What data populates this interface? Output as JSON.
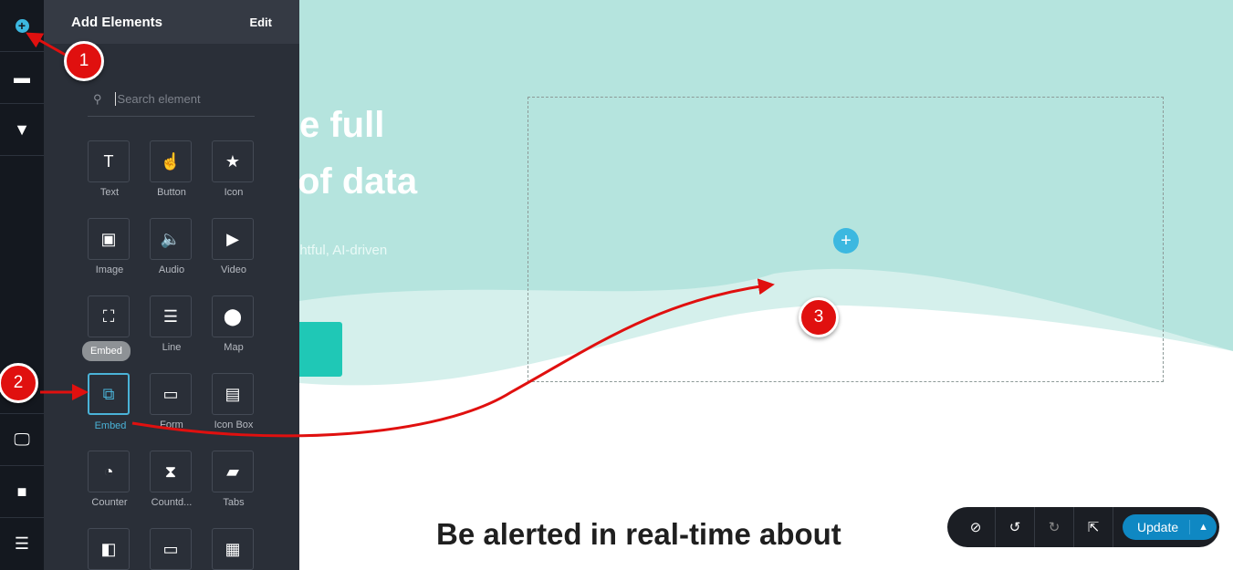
{
  "rail": {
    "items": [
      {
        "icon": "add-circle-icon"
      },
      {
        "icon": "layers-icon"
      },
      {
        "icon": "paint-roller-icon"
      },
      {
        "icon": "desktop-icon"
      },
      {
        "icon": "note-icon"
      },
      {
        "icon": "menu-icon"
      }
    ]
  },
  "panel": {
    "title": "Add Elements",
    "edit_label": "Edit",
    "search_placeholder": "Search element",
    "elements": [
      {
        "label": "Text",
        "icon": "T"
      },
      {
        "label": "Button",
        "icon": "☝"
      },
      {
        "label": "Icon",
        "icon": "★"
      },
      {
        "label": "Image",
        "icon": "▣"
      },
      {
        "label": "Audio",
        "icon": "🔈"
      },
      {
        "label": "Video",
        "icon": "▶"
      },
      {
        "label": "",
        "icon": "⛶"
      },
      {
        "label": "Line",
        "icon": "☰"
      },
      {
        "label": "Map",
        "icon": "⬤"
      },
      {
        "label": "Embed",
        "icon": "⧉"
      },
      {
        "label": "Form",
        "icon": "▭"
      },
      {
        "label": "Icon Box",
        "icon": "▤"
      },
      {
        "label": "Counter",
        "icon": "◔"
      },
      {
        "label": "Countd...",
        "icon": "⧗"
      },
      {
        "label": "Tabs",
        "icon": "▰"
      },
      {
        "label": "",
        "icon": "◧"
      },
      {
        "label": "",
        "icon": "▭"
      },
      {
        "label": "",
        "icon": "▦"
      }
    ],
    "tooltip": "Embed"
  },
  "canvas": {
    "hero_line1": "e full",
    "hero_line2": "of data",
    "hero_sub": "ghtful, AI-driven",
    "heading": "Be alerted in real-time about"
  },
  "toolbar": {
    "update_label": "Update"
  },
  "annotations": [
    "1",
    "2",
    "3"
  ],
  "colors": {
    "accent": "#4ab3d8",
    "annotation": "#e0100f",
    "hero": "#b5e4de"
  }
}
